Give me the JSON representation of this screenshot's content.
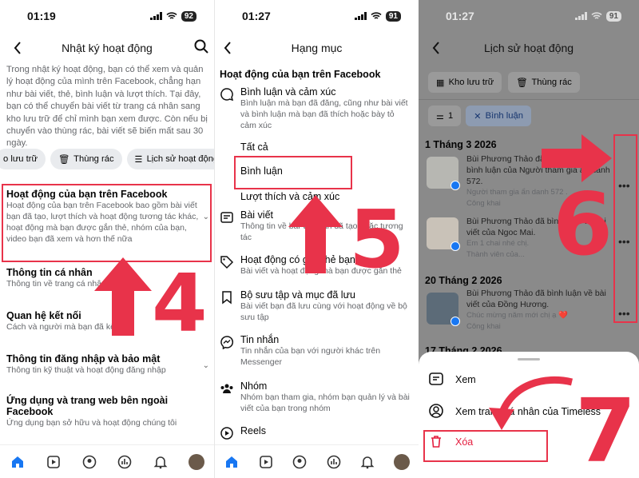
{
  "panel1": {
    "time": "01:19",
    "battery": "92",
    "title": "Nhật ký hoạt động",
    "intro": "Trong nhật ký hoạt động, bạn có thể xem và quản lý hoạt động của mình trên Facebook, chẳng hạn như bài viết, thẻ, bình luận và lượt thích. Tại đây, bạn có thể chuyển bài viết từ trang cá nhân sang kho lưu trữ để chỉ mình bạn xem được. Còn nếu bị chuyển vào thùng rác, bài viết sẽ biến mất sau 30 ngày.",
    "chips": [
      "o lưu trữ",
      "Thùng rác",
      "Lịch sử hoạt động"
    ],
    "sections": [
      {
        "title": "Hoạt động của bạn trên Facebook",
        "sub": "Hoạt động của bạn trên Facebook bao gồm bài viết bạn đã tạo, lượt thích và hoạt động tương tác khác, hoạt động mà bạn được gắn thẻ, nhóm của bạn, video bạn đã xem và hơn thế nữa"
      },
      {
        "title": "Thông tin cá nhân",
        "sub": "Thông tin về trang cá nhân của bạn"
      },
      {
        "title": "Quan hệ kết nối",
        "sub": "Cách và người mà bạn đã kết"
      },
      {
        "title": "Thông tin đăng nhập và bảo mật",
        "sub": "Thông tin kỹ thuật và hoạt động đăng nhập"
      },
      {
        "title": "Ứng dụng và trang web bên ngoài Facebook",
        "sub": "Ứng dụng bạn sở hữu và hoạt động chúng tôi"
      }
    ],
    "step": "4"
  },
  "panel2": {
    "time": "01:27",
    "battery": "91",
    "title": "Hạng mục",
    "heading": "Hoạt động của bạn trên Facebook",
    "items": [
      {
        "title": "Bình luận và cảm xúc",
        "sub": "Bình luận mà bạn đã đăng, cũng như bài viết và bình luận mà bạn đã thích hoặc bày tỏ cảm xúc"
      },
      {
        "title": "Bài viết",
        "sub": "Thông tin về bài viết bạn đã tạo hoặc tương tác"
      },
      {
        "title": "Hoạt động có gắn thẻ bạn",
        "sub": "Bài viết và hoạt động mà bạn được gắn thẻ"
      },
      {
        "title": "Bộ sưu tập và mục đã lưu",
        "sub": "Bài viết bạn đã lưu cùng với hoạt động về bộ sưu tập"
      },
      {
        "title": "Tin nhắn",
        "sub": "Tin nhắn của bạn với người khác trên Messenger"
      },
      {
        "title": "Nhóm",
        "sub": "Nhóm bạn tham gia, nhóm bạn quản lý và bài viết của bạn trong nhóm"
      },
      {
        "title": "Reels",
        "sub": ""
      }
    ],
    "subitems": [
      "Tất cả",
      "Bình luận",
      "Lượt thích và cảm xúc"
    ],
    "step": "5"
  },
  "panel3": {
    "time": "01:27",
    "battery": "91",
    "title": "Lịch sử hoạt động",
    "buttons": [
      "Kho lưu trữ",
      "Thùng rác"
    ],
    "filter_count": "1",
    "filter_label": "Bình luận",
    "dates": [
      "1 Tháng 3 2026",
      "20 Tháng 2 2026",
      "17 Tháng 2 2026"
    ],
    "entries": [
      {
        "text": "Bùi Phương Thảo đã bình luận về bình luận của Người tham gia ẩn danh 572.",
        "quote": "Người tham gia ẩn danh 572 .",
        "privacy": "Công khai"
      },
      {
        "text": "Bùi Phương Thảo đã bình luận về bài viết của Ngoc Mai.",
        "quote": "Em 1 chai nhé chị.",
        "privacy": "Thành viên của..."
      },
      {
        "text": "Bùi Phương Thảo đã bình luận về bài viết của Đồng Hương.",
        "quote": "Chúc mừng năm mới chị ạ ❤️",
        "privacy": "Công khai"
      }
    ],
    "sheet": [
      "Xem",
      "Xem trang cá nhân của Timeless",
      "Xóa"
    ],
    "steps": [
      "6",
      "7"
    ]
  },
  "colors": {
    "accent": "#e8334a",
    "brand": "#1877f2"
  }
}
